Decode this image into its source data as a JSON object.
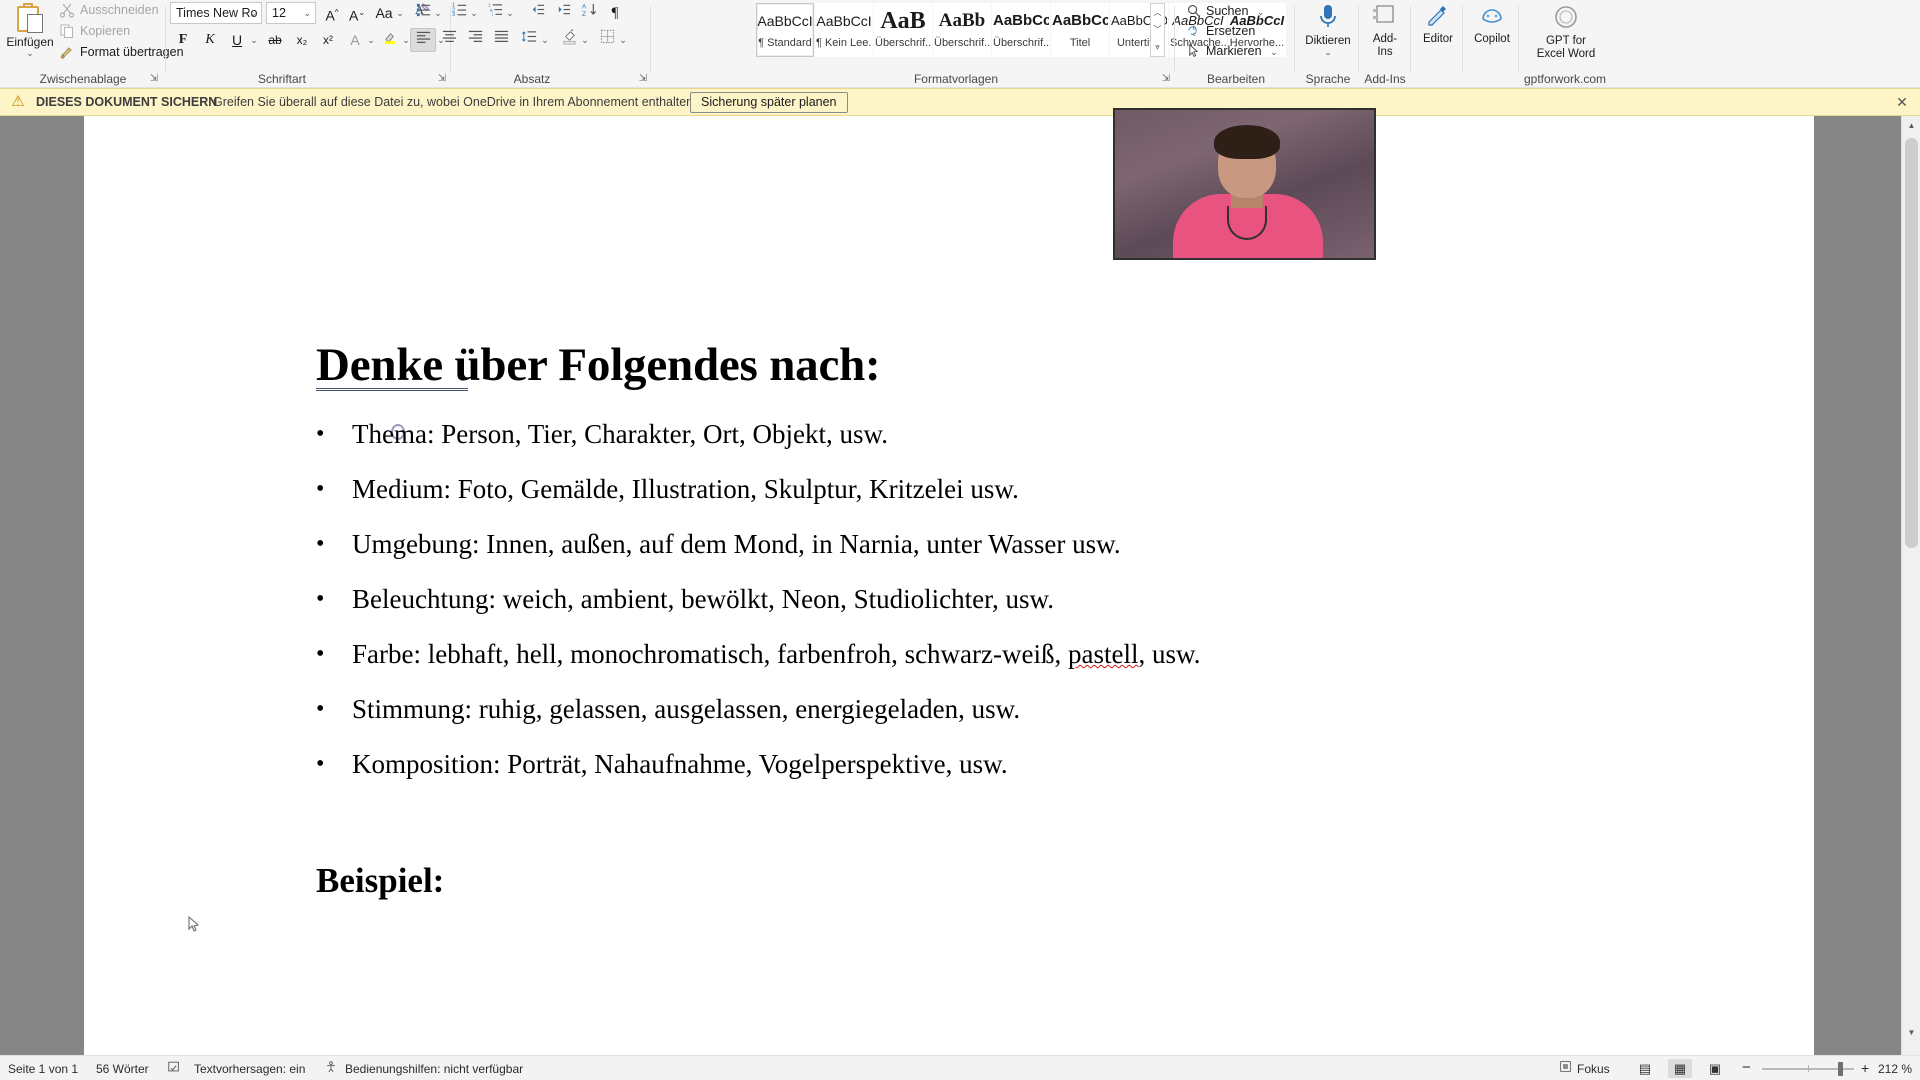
{
  "ribbon": {
    "groups": [
      {
        "label": "Zwischenablage"
      },
      {
        "label": "Schriftart"
      },
      {
        "label": "Absatz"
      },
      {
        "label": "Formatvorlagen"
      },
      {
        "label": "Bearbeiten"
      },
      {
        "label": "Sprache"
      },
      {
        "label": "Add-Ins"
      },
      {
        "label": "gptforwork.com"
      }
    ],
    "clipboard": {
      "paste_label": "Einfügen",
      "cut_label": "Ausschneiden",
      "copy_label": "Kopieren",
      "format_painter_label": "Format übertragen"
    },
    "font": {
      "family_value": "Times New Ro",
      "size_value": "12",
      "grow_label": "A",
      "shrink_label": "A",
      "case_label": "Aa",
      "clear_format_label": "A",
      "bold_label": "F",
      "italic_label": "K",
      "underline_label": "U",
      "strike_label": "ab",
      "subscript_label": "x₂",
      "superscript_label": "x²",
      "text_effects_label": "A",
      "highlight_label": "✏",
      "font_color_label": "A"
    },
    "paragraph": {
      "bullets_label": "☰",
      "numbering_label": "☰",
      "multilevel_label": "☰",
      "decrease_indent_label": "⇤",
      "increase_indent_label": "⇥",
      "sort_label": "AZ↓",
      "marks_label": "¶",
      "align_left_label": "☰",
      "align_center_label": "☰",
      "align_right_label": "☰",
      "justify_label": "☰",
      "line_spacing_label": "↕",
      "shading_label": "▩",
      "borders_label": "▦"
    },
    "styles": [
      {
        "preview": "AaBbCcI",
        "name": "¶ Standard",
        "serif": false,
        "bold": false,
        "italic": false,
        "size": 14,
        "active": true
      },
      {
        "preview": "AaBbCcI",
        "name": "¶ Kein Lee...",
        "serif": false,
        "bold": false,
        "italic": false,
        "size": 14,
        "active": false
      },
      {
        "preview": "AaB",
        "name": "Überschrif...",
        "serif": true,
        "bold": true,
        "italic": false,
        "size": 24,
        "active": false
      },
      {
        "preview": "AaBb",
        "name": "Überschrif...",
        "serif": true,
        "bold": true,
        "italic": false,
        "size": 19,
        "active": false
      },
      {
        "preview": "AaBbCc",
        "name": "Überschrif...",
        "serif": false,
        "bold": true,
        "italic": false,
        "size": 15,
        "active": false
      },
      {
        "preview": "AaBbCc",
        "name": "Titel",
        "serif": false,
        "bold": true,
        "italic": false,
        "size": 15,
        "active": false
      },
      {
        "preview": "AaBbCcD",
        "name": "Untertitel",
        "serif": false,
        "bold": false,
        "italic": false,
        "size": 13,
        "active": false
      },
      {
        "preview": "AaBbCcI",
        "name": "Schwache...",
        "serif": false,
        "bold": false,
        "italic": true,
        "size": 13,
        "active": false
      },
      {
        "preview": "AaBbCcI",
        "name": "Hervorhe...",
        "serif": false,
        "bold": true,
        "italic": true,
        "size": 13,
        "active": false
      }
    ],
    "editing": {
      "find_label": "Suchen",
      "replace_label": "Ersetzen",
      "select_label": "Markieren"
    },
    "right_buttons": [
      {
        "label": "Diktieren",
        "has_chevron": true,
        "icon": "microphone-icon"
      },
      {
        "label": "Add-\nIns",
        "label_line1": "Add-",
        "label_line2": "Ins",
        "has_chevron": false,
        "icon": "addins-icon"
      },
      {
        "label": "Editor",
        "has_chevron": false,
        "icon": "editor-icon"
      },
      {
        "label": "Copilot",
        "has_chevron": false,
        "icon": "copilot-icon"
      },
      {
        "label_line1": "GPT for",
        "label_line2": "Excel Word",
        "has_chevron": false,
        "icon": "gpt-icon"
      }
    ]
  },
  "banner": {
    "title": "DIESES DOKUMENT SICHERN",
    "message": "Greifen Sie überall auf diese Datei zu, wobei OneDrive in Ihrem Abonnement enthalten ist.",
    "button_label": "Sicherung später planen",
    "close_label": "✕",
    "warning_icon": "⚠",
    "background": "#fdf4c8"
  },
  "document": {
    "title": "Denke über Folgendes nach:",
    "bullets": [
      {
        "pre": "Thema: Person, Tier, Charakter, Ort, Objekt, usw.",
        "misspelled": "",
        "post": ""
      },
      {
        "pre": "Medium: Foto, Gemälde, Illustration, Skulptur, Kritzelei usw.",
        "misspelled": "",
        "post": ""
      },
      {
        "pre": "Umgebung: Innen, außen, auf dem Mond, in Narnia, unter Wasser usw.",
        "misspelled": "",
        "post": ""
      },
      {
        "pre": "Beleuchtung: weich, ambient, bewölkt, Neon, Studiolichter, usw.",
        "misspelled": "",
        "post": ""
      },
      {
        "pre": "Farbe: lebhaft, hell, monochromatisch, farbenfroh, schwarz-weiß, ",
        "misspelled": "pastell",
        "post": ", usw."
      },
      {
        "pre": "Stimmung: ruhig, gelassen, ausgelassen, energiegeladen, usw.",
        "misspelled": "",
        "post": ""
      },
      {
        "pre": "Komposition: Porträt, Nahaufnahme, Vogelperspektive, usw.",
        "misspelled": "",
        "post": ""
      }
    ],
    "bullet_marker": "•",
    "subtitle": "Beispiel:"
  },
  "statusbar": {
    "page_info": "Seite 1 von 1",
    "word_count": "56 Wörter",
    "proofing_icon": "proofing-icon",
    "text_predictions": "Textvorhersagen: ein",
    "accessibility": "Bedienungshilfen: nicht verfügbar",
    "focus_label": "Fokus",
    "zoom_value": "212 %",
    "zoom_out_label": "−",
    "zoom_in_label": "+",
    "view_read_label": "▤",
    "view_print_label": "▦",
    "view_web_label": "▣"
  }
}
